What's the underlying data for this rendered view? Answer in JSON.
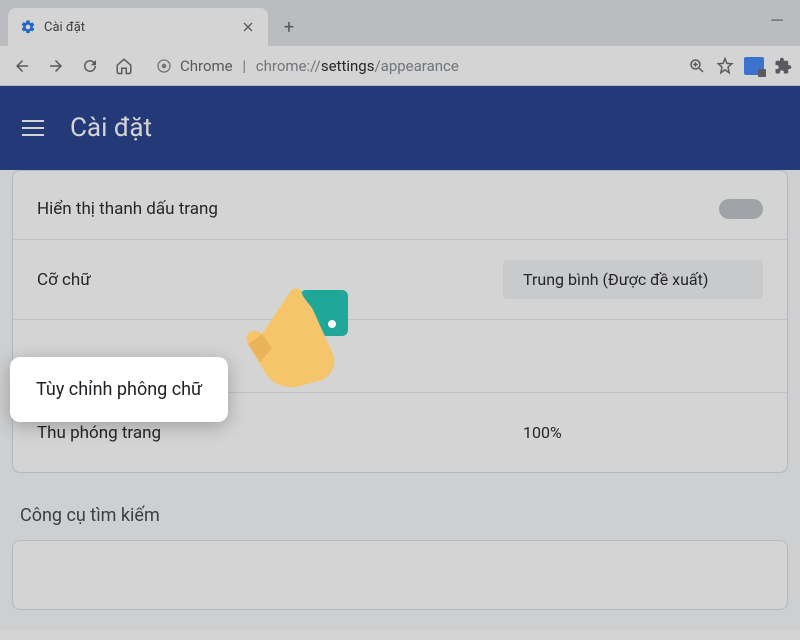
{
  "tab": {
    "title": "Cài đặt"
  },
  "address": {
    "origin": "Chrome",
    "scheme": "chrome://",
    "path_strong": "settings",
    "path_tail": "/appearance"
  },
  "header": {
    "title": "Cài đặt"
  },
  "rows": {
    "bookmarks_bar": "Hiển thị thanh dấu trang",
    "font_size": {
      "label": "Cỡ chữ",
      "value": "Trung bình (Được đề xuất)"
    },
    "customize_fonts": "Tùy chỉnh phông chữ",
    "page_zoom": {
      "label": "Thu phóng trang",
      "value": "100%"
    }
  },
  "sections": {
    "search_engine": "Công cụ tìm kiếm"
  }
}
